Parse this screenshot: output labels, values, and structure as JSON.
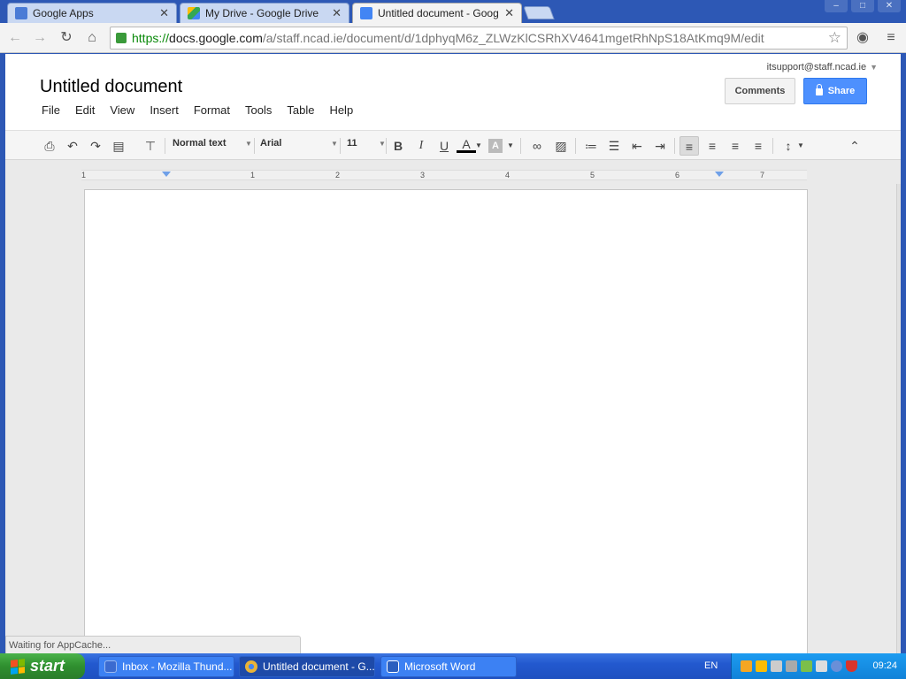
{
  "browser": {
    "tabs": [
      {
        "title": "Google Apps",
        "color": "#4a7bd6",
        "active": false
      },
      {
        "title": "My Drive - Google Drive",
        "color": "#34a853",
        "active": false
      },
      {
        "title": "Untitled document - Google D",
        "color": "#4285f4",
        "active": true
      }
    ],
    "url": {
      "scheme": "https://",
      "host": "docs.google.com",
      "path": "/a/staff.ncad.ie/document/d/1dphyqM6z_ZLWzKlCSRhXV4641mgetRhNpS18AtKmq9M/edit"
    }
  },
  "doc": {
    "title": "Untitled document",
    "account": "itsupport@staff.ncad.ie",
    "comments_label": "Comments",
    "share_label": "Share",
    "menus": [
      "File",
      "Edit",
      "View",
      "Insert",
      "Format",
      "Tools",
      "Table",
      "Help"
    ],
    "style_select": "Normal text",
    "font_select": "Arial",
    "size_select": "11",
    "ruler_labels": [
      "1",
      "1",
      "2",
      "3",
      "4",
      "5",
      "6",
      "7"
    ],
    "status": "Waiting for AppCache..."
  },
  "taskbar": {
    "start_label": "start",
    "tasks": [
      {
        "title": "Inbox - Mozilla Thund...",
        "color": "#3b6bd0"
      },
      {
        "title": "Untitled document - G...",
        "color": "#e8b339"
      },
      {
        "title": "Microsoft Word",
        "color": "#2b5fbf"
      }
    ],
    "lang": "EN",
    "clock": "09:24"
  },
  "colors": {
    "share_blue": "#4d90fe",
    "xp_taskbar": "#2359cf",
    "xp_start_green": "#2f8f2f"
  }
}
